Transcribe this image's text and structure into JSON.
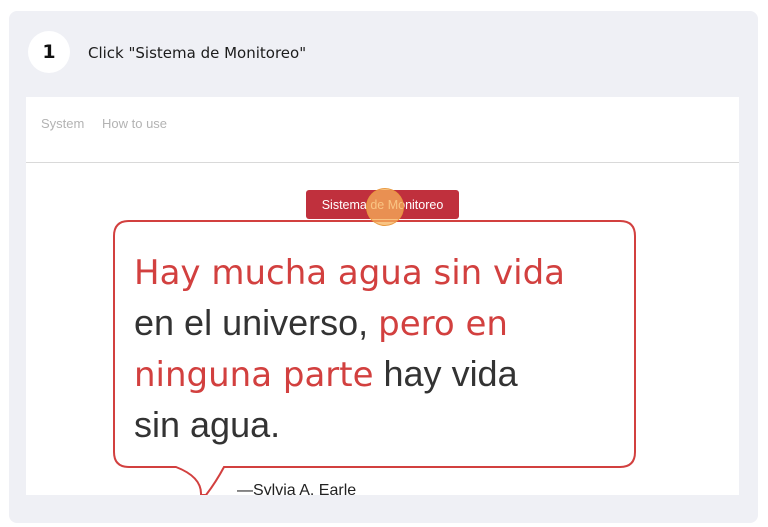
{
  "step": {
    "number": "1",
    "instruction": "Click \"Sistema de Monitoreo\""
  },
  "nav": {
    "items": [
      "System",
      "How to use"
    ]
  },
  "main": {
    "monitor_button": "Sistema de Monitoreo"
  },
  "quote": {
    "red1": "Hay mucha agua sin vida",
    "dark1": "en el universo, ",
    "red2": "pero en",
    "red3": "ninguna parte",
    "dark2": " hay vida",
    "dark3": "sin agua.",
    "author": "—Sylvia A. Earle"
  },
  "colors": {
    "accent": "#c0303d",
    "quote_red": "#d2403f",
    "click_marker": "#f7b05a"
  }
}
